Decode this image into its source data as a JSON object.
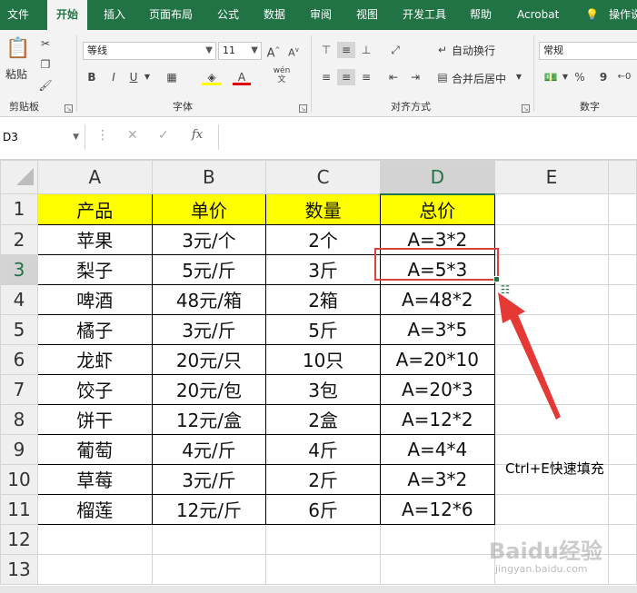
{
  "ribbon_tabs": [
    "文件",
    "开始",
    "插入",
    "页面布局",
    "公式",
    "数据",
    "审阅",
    "视图",
    "开发工具",
    "帮助",
    "Acrobat",
    "操作说"
  ],
  "ribbon": {
    "clipboard": {
      "paste_label": "粘贴",
      "group_label": "剪贴板"
    },
    "font": {
      "font_name": "等线",
      "font_size": "11",
      "bold": "B",
      "italic": "I",
      "underline": "U",
      "group_label": "字体",
      "wen_label": "wén\n文",
      "font_color_letter": "A"
    },
    "alignment": {
      "wrap_text": "自动换行",
      "merge_center": "合并后居中",
      "group_label": "对齐方式"
    },
    "number": {
      "format": "常规",
      "percent": "%",
      "comma": "9",
      "group_label": "数字"
    }
  },
  "formula_bar": {
    "name_box": "D3",
    "fx_label": "fx",
    "content": ""
  },
  "columns": [
    "A",
    "B",
    "C",
    "D",
    "E"
  ],
  "selected_column": "D",
  "rows": [
    {
      "n": "1",
      "cells": [
        "产品",
        "单价",
        "数量",
        "总价",
        ""
      ]
    },
    {
      "n": "2",
      "cells": [
        "苹果",
        "3元/个",
        "2个",
        "A=3*2",
        ""
      ]
    },
    {
      "n": "3",
      "cells": [
        "梨子",
        "5元/斤",
        "3斤",
        "A=5*3",
        ""
      ]
    },
    {
      "n": "4",
      "cells": [
        "啤酒",
        "48元/箱",
        "2箱",
        "A=48*2",
        ""
      ]
    },
    {
      "n": "5",
      "cells": [
        "橘子",
        "3元/斤",
        "5斤",
        "A=3*5",
        ""
      ]
    },
    {
      "n": "6",
      "cells": [
        "龙虾",
        "20元/只",
        "10只",
        "A=20*10",
        ""
      ]
    },
    {
      "n": "7",
      "cells": [
        "饺子",
        "20元/包",
        "3包",
        "A=20*3",
        ""
      ]
    },
    {
      "n": "8",
      "cells": [
        "饼干",
        "12元/盒",
        "2盒",
        "A=12*2",
        ""
      ]
    },
    {
      "n": "9",
      "cells": [
        "葡萄",
        "4元/斤",
        "4斤",
        "A=4*4",
        ""
      ]
    },
    {
      "n": "10",
      "cells": [
        "草莓",
        "3元/斤",
        "2斤",
        "A=3*2",
        ""
      ]
    },
    {
      "n": "11",
      "cells": [
        "榴莲",
        "12元/斤",
        "6斤",
        "A=12*6",
        ""
      ]
    },
    {
      "n": "12",
      "cells": [
        "",
        "",
        "",
        "",
        ""
      ]
    },
    {
      "n": "13",
      "cells": [
        "",
        "",
        "",
        "",
        ""
      ]
    }
  ],
  "annotation": "Ctrl+E快速填充",
  "watermark": {
    "main": "Baidu经验",
    "sub": "jingyan.baidu.com"
  },
  "colors": {
    "excel_green": "#217346",
    "header_yellow": "#ffff00",
    "highlight_red": "#d9413a"
  }
}
